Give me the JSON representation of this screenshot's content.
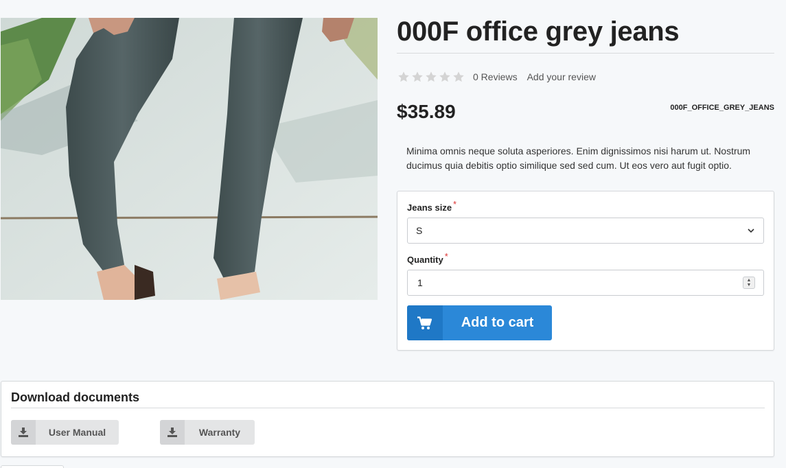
{
  "product": {
    "title": "000F office grey jeans",
    "rating": {
      "stars_filled": 0,
      "stars_total": 5,
      "reviews_label": "0 Reviews",
      "add_review_label": "Add your review"
    },
    "price": "$35.89",
    "sku": "000F_OFFICE_GREY_JEANS",
    "description": "Minima omnis neque soluta asperiores. Enim dignissimos nisi harum ut. Nostrum ducimus quia debitis optio similique sed sed cum. Ut eos vero aut fugit optio.",
    "image_icon": "product-photo-grey-jeans"
  },
  "options": {
    "size_label": "Jeans size",
    "size_required_mark": "*",
    "size_value": "S",
    "quantity_label": "Quantity",
    "quantity_required_mark": "*",
    "quantity_value": "1"
  },
  "cart": {
    "button_label": "Add to cart",
    "icon": "shopping-cart-icon"
  },
  "documents": {
    "title": "Download documents",
    "items": [
      {
        "label": "User Manual",
        "icon": "download-icon"
      },
      {
        "label": "Warranty",
        "icon": "download-icon"
      }
    ]
  },
  "colors": {
    "accent": "#2b88d8",
    "accent_dark": "#1f78c6",
    "star_empty": "#d4d4d4",
    "required": "#dd3333"
  }
}
